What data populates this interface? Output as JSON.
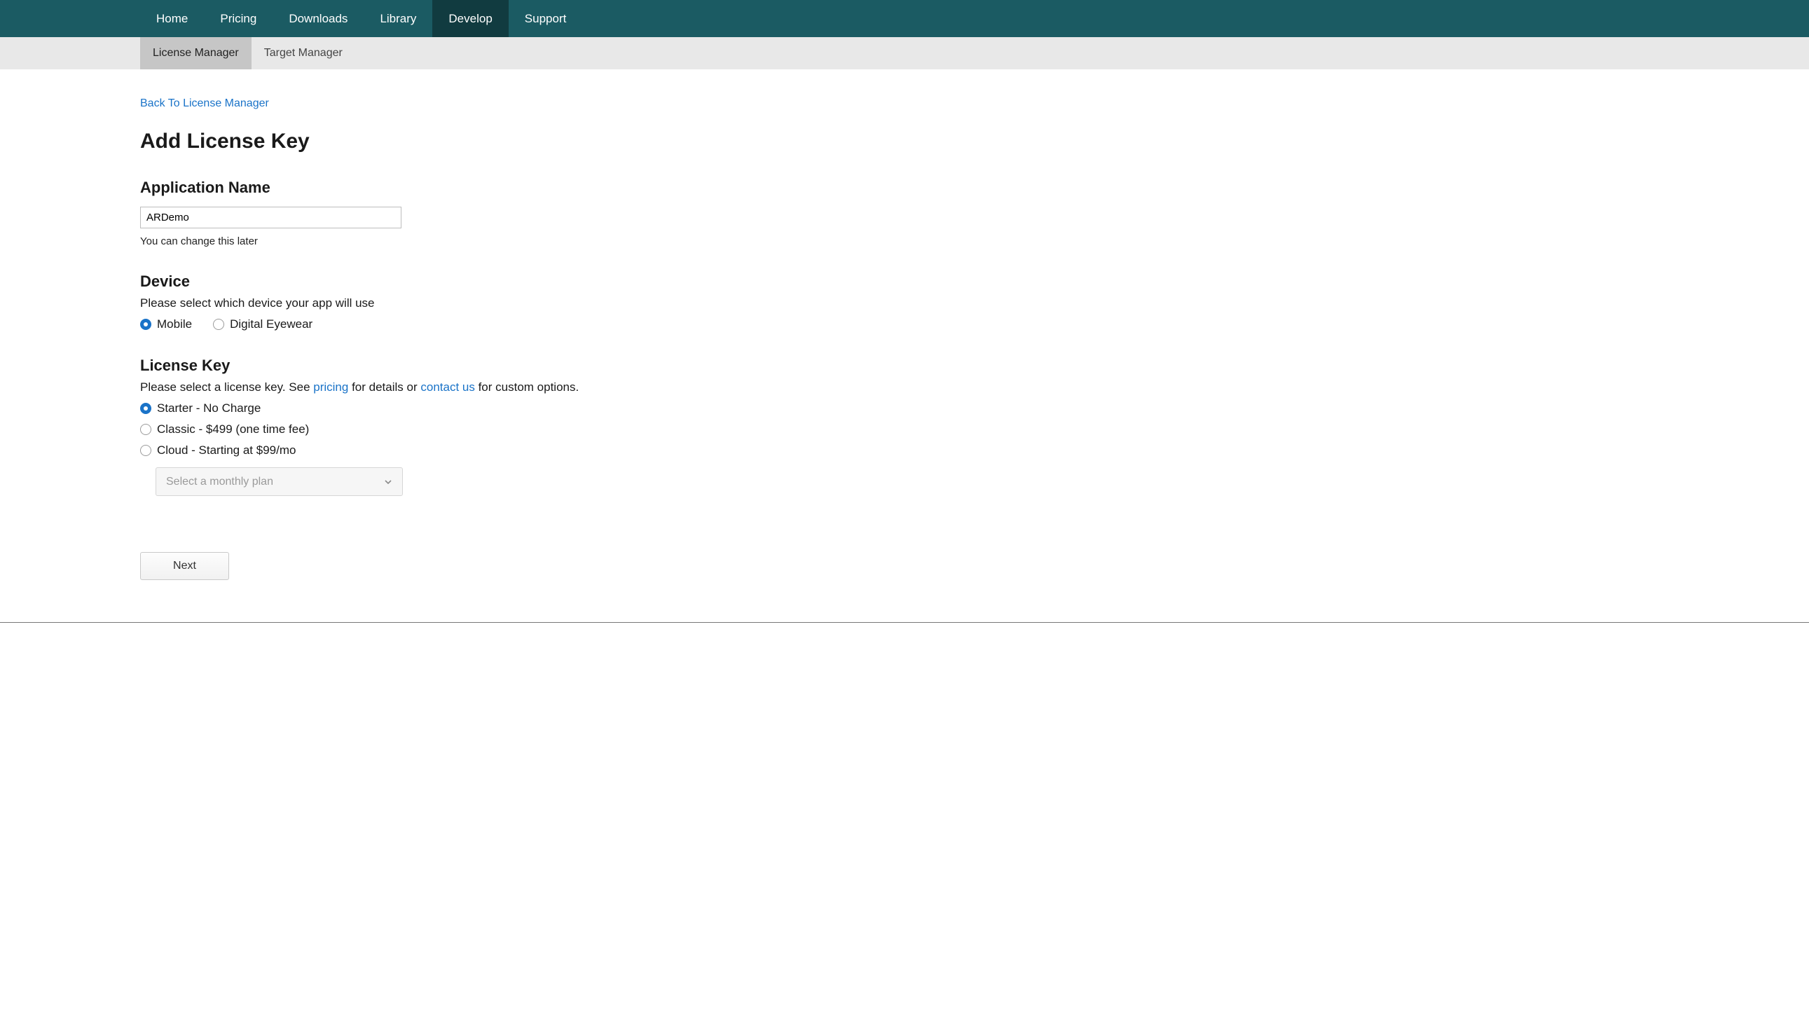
{
  "nav": {
    "items": [
      "Home",
      "Pricing",
      "Downloads",
      "Library",
      "Develop",
      "Support"
    ],
    "active": "Develop"
  },
  "subnav": {
    "items": [
      "License Manager",
      "Target Manager"
    ],
    "active": "License Manager"
  },
  "page": {
    "back_link": "Back To License Manager",
    "title": "Add License Key"
  },
  "app_name": {
    "heading": "Application Name",
    "value": "ARDemo",
    "hint": "You can change this later"
  },
  "device": {
    "heading": "Device",
    "subtext": "Please select which device your app will use",
    "options": [
      {
        "label": "Mobile",
        "checked": true
      },
      {
        "label": "Digital Eyewear",
        "checked": false
      }
    ]
  },
  "license": {
    "heading": "License Key",
    "subtext_pre": "Please select a license key. See ",
    "link_pricing": "pricing",
    "subtext_mid": " for details or ",
    "link_contact": "contact us",
    "subtext_post": " for custom options.",
    "options": [
      {
        "label": "Starter - No Charge",
        "checked": true
      },
      {
        "label": "Classic - $499 (one time fee)",
        "checked": false
      },
      {
        "label": "Cloud - Starting at $99/mo",
        "checked": false
      }
    ],
    "dropdown_placeholder": "Select a monthly plan"
  },
  "next_label": "Next"
}
